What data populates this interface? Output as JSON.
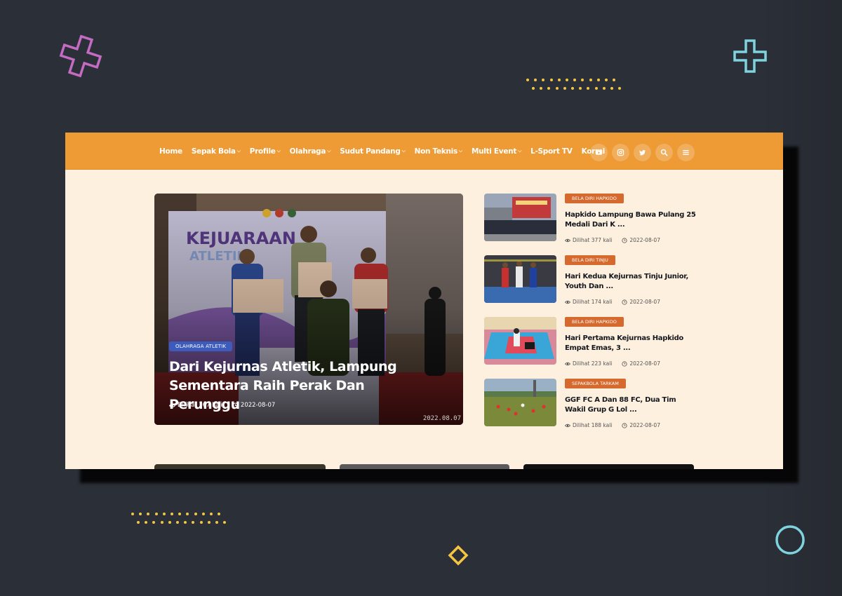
{
  "nav": {
    "items": [
      {
        "label": "Home",
        "dropdown": false
      },
      {
        "label": "Sepak Bola",
        "dropdown": true
      },
      {
        "label": "Profile",
        "dropdown": true
      },
      {
        "label": "Olahraga",
        "dropdown": true
      },
      {
        "label": "Sudut Pandang",
        "dropdown": true
      },
      {
        "label": "Non Teknis",
        "dropdown": true
      },
      {
        "label": "Multi Event",
        "dropdown": true
      },
      {
        "label": "L-Sport TV",
        "dropdown": false
      },
      {
        "label": "Kormi",
        "dropdown": false
      }
    ],
    "icons": [
      "youtube-icon",
      "instagram-icon",
      "twitter-icon",
      "search-icon",
      "menu-icon"
    ]
  },
  "hero": {
    "category": "OLAHRAGA ATLETIK",
    "title": "Dari Kejurnas Atletik, Lampung Sementara Raih Perak Dan Perunggu",
    "views": "Dilihat 167 kali",
    "date": "2022-08-07",
    "photo_stamp": "2022.08.07"
  },
  "side_posts": [
    {
      "category": "BELA DIRI HAPKIDO",
      "title": "Hapkido Lampung Bawa Pulang 25 Medali Dari K ...",
      "views": "Dilihat 377 kali",
      "date": "2022-08-07"
    },
    {
      "category": "BELA DIRI TINJU",
      "title": "Hari Kedua Kejurnas Tinju Junior, Youth Dan ...",
      "views": "Dilihat 174 kali",
      "date": "2022-08-07"
    },
    {
      "category": "BELA DIRI HAPKIDO",
      "title": "Hari Pertama Kejurnas Hapkido Empat Emas, 3 ...",
      "views": "Dilihat 223 kali",
      "date": "2022-08-07"
    },
    {
      "category": "SEPAKBOLA TARKAM",
      "title": "GGF FC A Dan 88 FC, Dua Tim Wakil Grup G Lol ...",
      "views": "Dilihat 188 kali",
      "date": "2022-08-07"
    }
  ],
  "colors": {
    "nav_bg": "#ee9a35",
    "page_bg": "#fdf0de",
    "hero_badge": "#3c5bbd",
    "side_badge": "#d5692e",
    "backdrop": "#2b2f37"
  }
}
